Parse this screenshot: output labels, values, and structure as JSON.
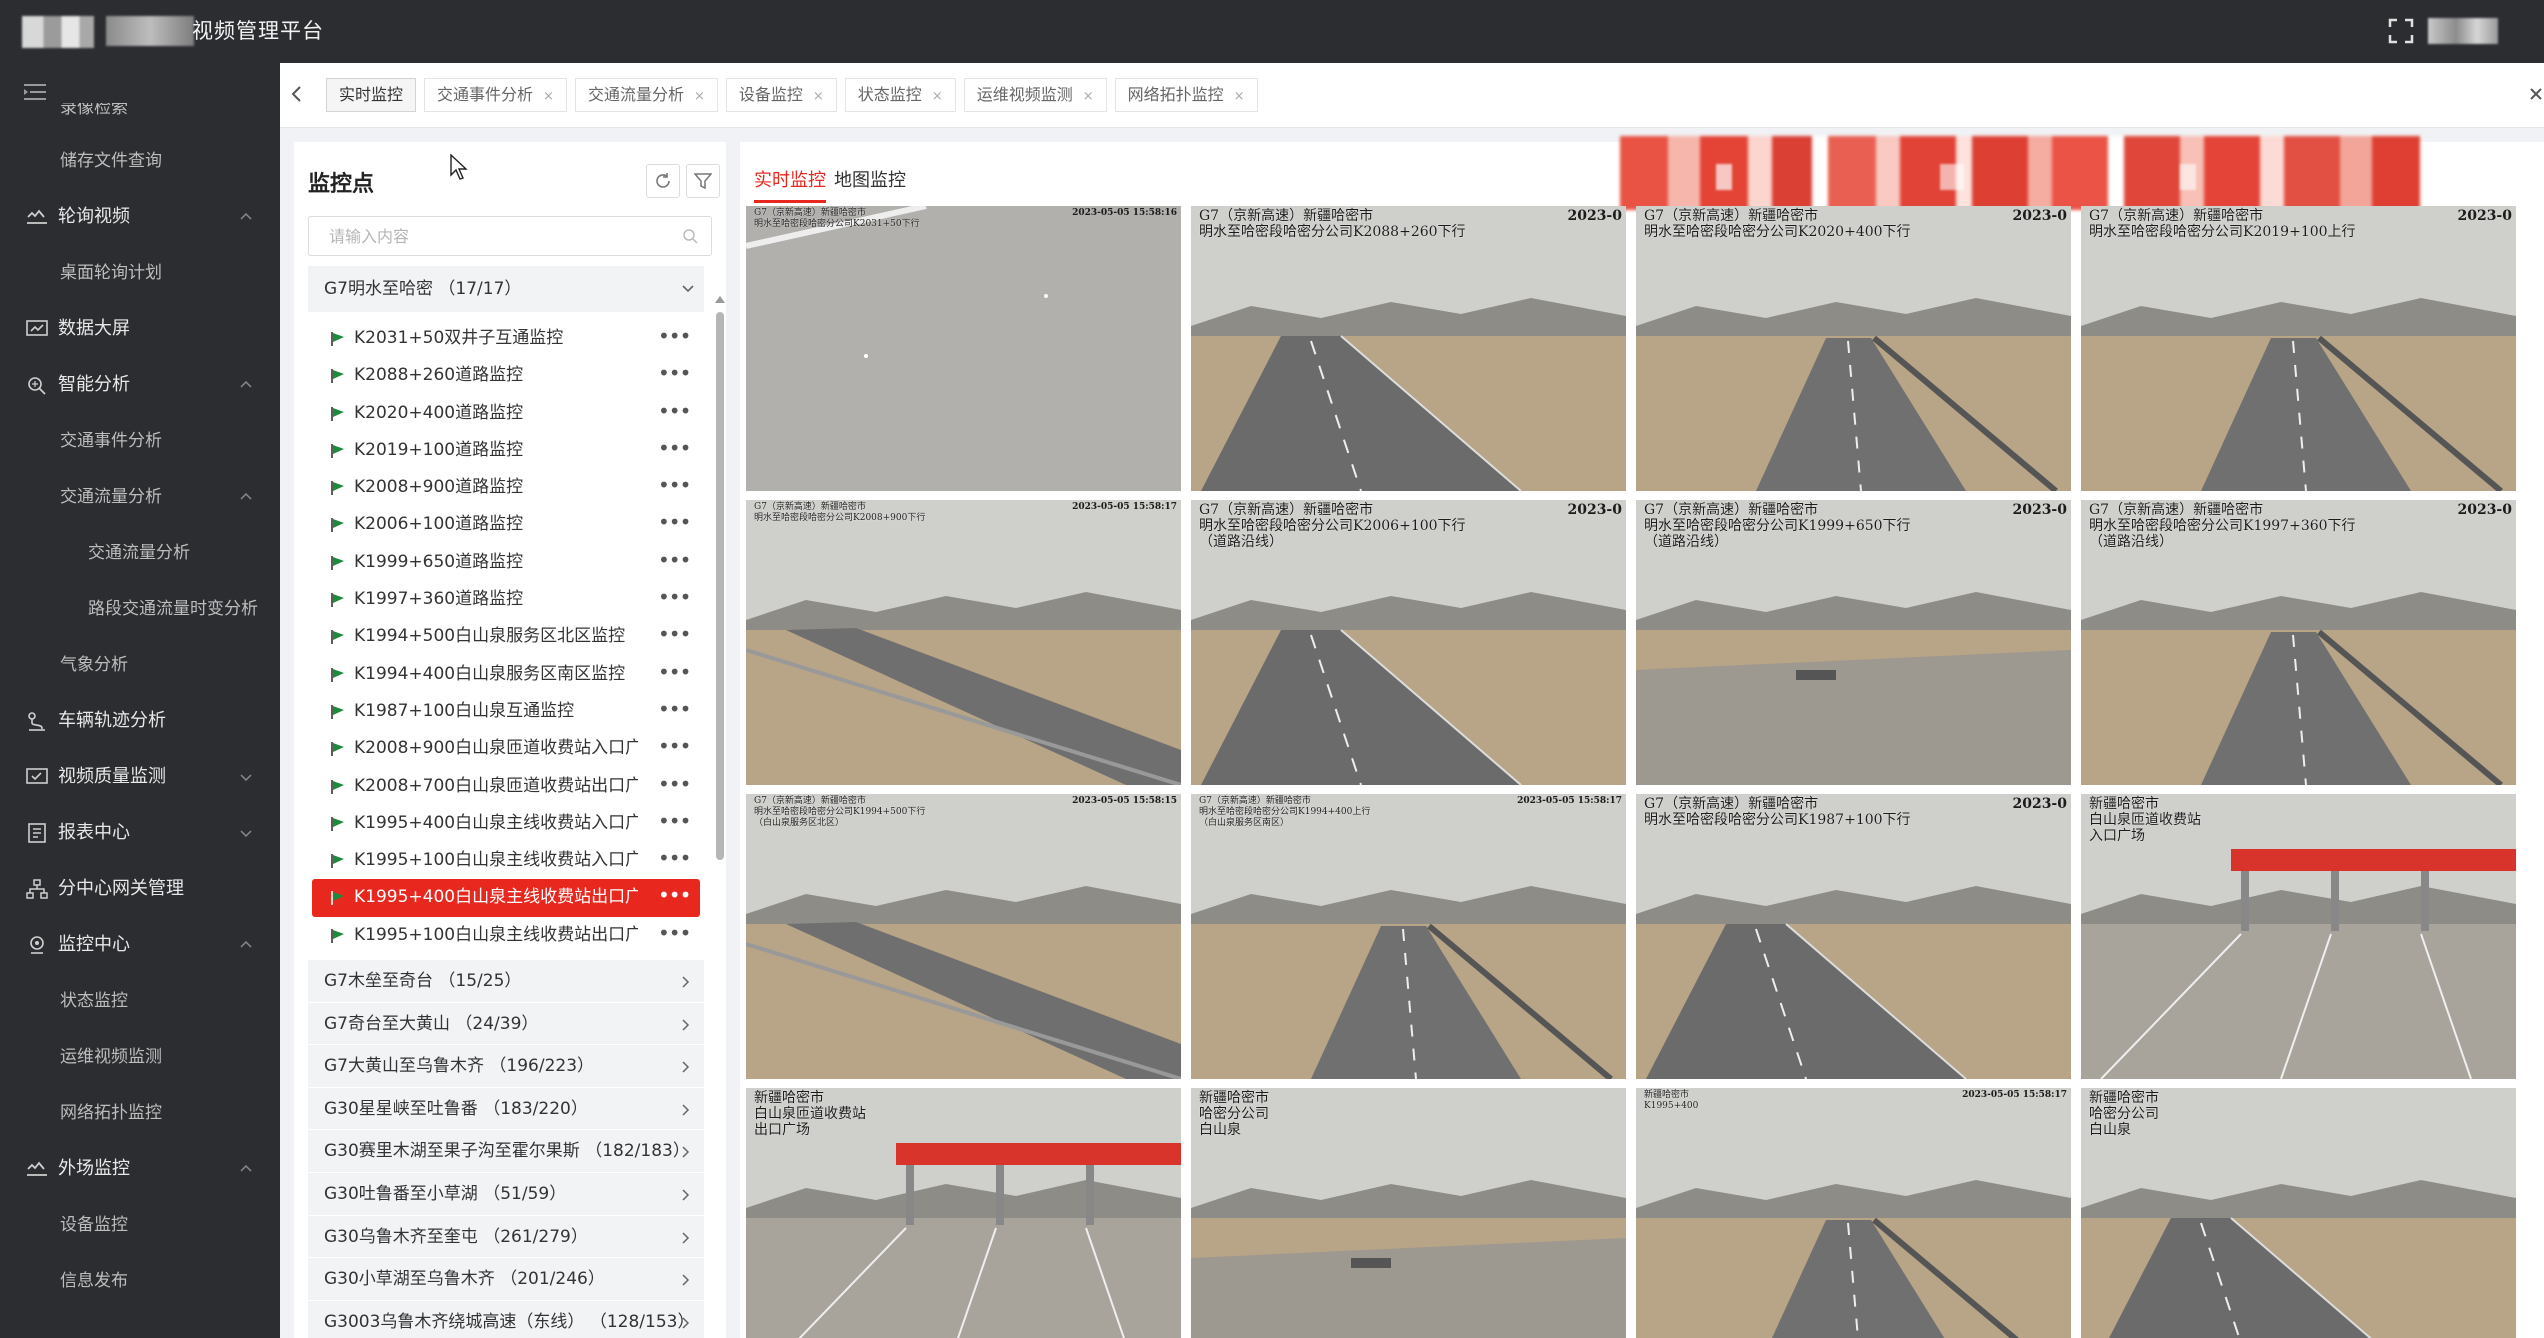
{
  "app": {
    "title": "视频管理平台"
  },
  "sidebar": {
    "partial_top": "录像检索",
    "items": [
      {
        "label": "储存文件查询",
        "level": "sub"
      },
      {
        "label": "轮询视频",
        "level": "top",
        "icon": "cloud-icon",
        "expanded": true
      },
      {
        "label": "桌面轮询计划",
        "level": "sub"
      },
      {
        "label": "数据大屏",
        "level": "top",
        "icon": "chart-screen-icon"
      },
      {
        "label": "智能分析",
        "level": "top",
        "icon": "brain-icon",
        "expanded": true
      },
      {
        "label": "交通事件分析",
        "level": "sub"
      },
      {
        "label": "交通流量分析",
        "level": "sub",
        "expanded": true,
        "active": true
      },
      {
        "label": "交通流量分析",
        "level": "sub2"
      },
      {
        "label": "路段交通流量时变分析",
        "level": "sub2"
      },
      {
        "label": "气象分析",
        "level": "sub"
      },
      {
        "label": "车辆轨迹分析",
        "level": "top",
        "icon": "route-icon"
      },
      {
        "label": "视频质量监测",
        "level": "top",
        "icon": "monitor-check-icon",
        "expanded": false
      },
      {
        "label": "报表中心",
        "level": "top",
        "icon": "report-icon",
        "expanded": false
      },
      {
        "label": "分中心网关管理",
        "level": "top",
        "icon": "network-icon"
      },
      {
        "label": "监控中心",
        "level": "top",
        "icon": "location-icon",
        "expanded": true
      },
      {
        "label": "状态监控",
        "level": "sub"
      },
      {
        "label": "运维视频监测",
        "level": "sub"
      },
      {
        "label": "网络拓扑监控",
        "level": "sub"
      },
      {
        "label": "外场监控",
        "level": "top",
        "icon": "cloud-icon",
        "expanded": true
      },
      {
        "label": "设备监控",
        "level": "sub"
      },
      {
        "label": "信息发布",
        "level": "sub"
      }
    ]
  },
  "tabs": [
    {
      "label": "实时监控",
      "active": true,
      "closable": false
    },
    {
      "label": "交通事件分析",
      "closable": true
    },
    {
      "label": "交通流量分析",
      "closable": true
    },
    {
      "label": "设备监控",
      "closable": true
    },
    {
      "label": "状态监控",
      "closable": true
    },
    {
      "label": "运维视频监测",
      "closable": true
    },
    {
      "label": "网络拓扑监控",
      "closable": true
    }
  ],
  "tab_close_glyph": "×",
  "monitor_panel": {
    "title": "监控点",
    "search_placeholder": "请输入内容",
    "expanded_group": {
      "label": "G7明水至哈密 （17/17）",
      "nodes": [
        "K2031+50双井子互通监控",
        "K2088+260道路监控",
        "K2020+400道路监控",
        "K2019+100道路监控",
        "K2008+900道路监控",
        "K2006+100道路监控",
        "K1999+650道路监控",
        "K1997+360道路监控",
        "K1994+500白山泉服务区北区监控",
        "K1994+400白山泉服务区南区监控",
        "K1987+100白山泉互通监控",
        "K2008+900白山泉匝道收费站入口广",
        "K2008+700白山泉匝道收费站出口广",
        "K1995+400白山泉主线收费站入口广",
        "K1995+100白山泉主线收费站入口广",
        "K1995+400白山泉主线收费站出口广",
        "K1995+100白山泉主线收费站出口广"
      ],
      "selected_index": 15,
      "more_glyph": "•••"
    },
    "collapsed_groups": [
      "G7木垒至奇台 （15/25）",
      "G7奇台至大黄山 （24/39）",
      "G7大黄山至乌鲁木齐 （196/223）",
      "G30星星峡至吐鲁番 （183/220）",
      "G30赛里木湖至果子沟至霍尔果斯 （182/183）",
      "G30吐鲁番至小草湖 （51/59）",
      "G30乌鲁木齐至奎屯 （261/279）",
      "G30小草湖至乌鲁木齐 （201/246）",
      "G3003乌鲁木齐绕城高速（东线） （128/153）"
    ]
  },
  "video_panel": {
    "tabs": [
      {
        "label": "实时监控",
        "active": true
      },
      {
        "label": "地图监控",
        "active": false
      }
    ],
    "cameras": [
      {
        "overlay": "G7（京新高速）新疆哈密市\n明水至哈密段哈密分公司K2031+50下行",
        "ts": "2023-05-05 15:58:16",
        "small": true,
        "scene": "snow"
      },
      {
        "overlay": "G7（京新高速）新疆哈密市\n明水至哈密段哈密分公司K2088+260下行",
        "ts": "2023-0",
        "scene": "road-left"
      },
      {
        "overlay": "G7（京新高速）新疆哈密市\n明水至哈密段哈密分公司K2020+400下行",
        "ts": "2023-0",
        "scene": "road-center"
      },
      {
        "overlay": "G7（京新高速）新疆哈密市\n明水至哈密段哈密分公司K2019+100上行",
        "ts": "2023-0",
        "scene": "road-center"
      },
      {
        "overlay": "G7（京新高速）新疆哈密市\n明水至哈密段哈密分公司K2008+900下行",
        "ts": "2023-05-05 15:58:17",
        "small": true,
        "scene": "road-diag"
      },
      {
        "overlay": "G7（京新高速）新疆哈密市\n明水至哈密段哈密分公司K2006+100下行\n（道路沿线）",
        "ts": "2023-0",
        "scene": "road-left"
      },
      {
        "overlay": "G7（京新高速）新疆哈密市\n明水至哈密段哈密分公司K1999+650下行\n（道路沿线）",
        "ts": "2023-0",
        "scene": "haze"
      },
      {
        "overlay": "G7（京新高速）新疆哈密市\n明水至哈密段哈密分公司K1997+360下行\n（道路沿线）",
        "ts": "2023-0",
        "scene": "road-center"
      },
      {
        "overlay": "G7（京新高速）新疆哈密市\n明水至哈密段哈密分公司K1994+500下行\n（白山泉服务区北区）",
        "ts": "2023-05-05 15:58:15",
        "small": true,
        "scene": "road-diag"
      },
      {
        "overlay": "G7（京新高速）新疆哈密市\n明水至哈密段哈密分公司K1994+400上行\n（白山泉服务区南区）",
        "ts": "2023-05-05 15:58:17",
        "small": true,
        "scene": "road-center"
      },
      {
        "overlay": "G7（京新高速）新疆哈密市\n明水至哈密段哈密分公司K1987+100下行",
        "ts": "2023-0",
        "scene": "road-left"
      },
      {
        "overlay": "新疆哈密市\n白山泉匝道收费站\n入口广场",
        "ts": "",
        "scene": "toll"
      },
      {
        "overlay": "新疆哈密市\n白山泉匝道收费站\n出口广场",
        "ts": "",
        "scene": "toll"
      },
      {
        "overlay": "新疆哈密市\n哈密分公司\n白山泉",
        "ts": "",
        "scene": "haze"
      },
      {
        "overlay": "新疆哈密市\nK1995+400",
        "ts": "2023-05-05 15:58:17",
        "small": true,
        "scene": "road-center"
      },
      {
        "overlay": "新疆哈密市\n哈密分公司\n白山泉",
        "ts": "",
        "scene": "road-left"
      }
    ]
  },
  "colors": {
    "accent": "#e8281f",
    "sidebar_bg": "#2b2d31",
    "flag_green": "#1e8a3c"
  }
}
